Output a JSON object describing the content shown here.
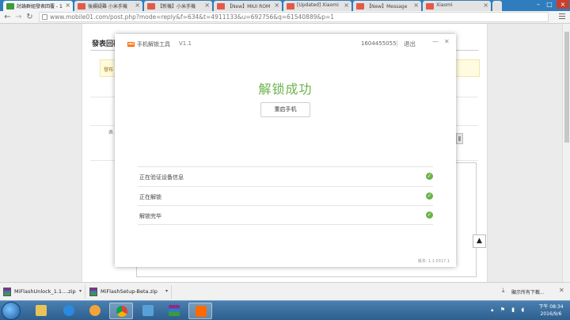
{
  "browser": {
    "tabs": [
      {
        "label": "討論群組發表回覆 - 1",
        "active": true
      },
      {
        "label": "後續疑難 小米手機",
        "active": false
      },
      {
        "label": "【新機】小米手機",
        "active": false
      },
      {
        "label": "【New】MIUI ROM",
        "active": false
      },
      {
        "label": "[Updated] Xiaomi",
        "active": false
      },
      {
        "label": "【New】Message",
        "active": false
      },
      {
        "label": "Xiaomi",
        "active": false
      }
    ],
    "address": "www.mobile01.com/post.php?mode=reply&f=634&t=4911133&u=692756&q=61540889&p=1"
  },
  "page": {
    "heading": "發表回覆",
    "notice": "發布",
    "field_label": "表"
  },
  "dialog": {
    "logo_text": "mi",
    "title": "手机解锁工具",
    "version": "V1.1",
    "account": "1604455055",
    "logout_label": "退出",
    "minimize_label": "—",
    "close_label": "✕",
    "success_text": "解锁成功",
    "reboot_label": "重启手机",
    "steps": [
      {
        "label": "正在验证设备信息",
        "done": true
      },
      {
        "label": "正在解锁",
        "done": true
      },
      {
        "label": "解锁完毕",
        "done": true
      }
    ],
    "build": "版本: 1.1.0317.1"
  },
  "downloads": {
    "items": [
      {
        "name": "MiFlashUnlock_1.1....zip"
      },
      {
        "name": "MiFlashSetup-Beta.zip"
      }
    ],
    "show_all": "顯示所有下載...",
    "close": "✕"
  },
  "taskbar": {
    "clock_time": "下午 08:34",
    "clock_date": "2016/9/6"
  },
  "colors": {
    "success_green": "#6bb24a",
    "mi_orange": "#ff6900",
    "tab_strip": "#2f7dbd"
  }
}
